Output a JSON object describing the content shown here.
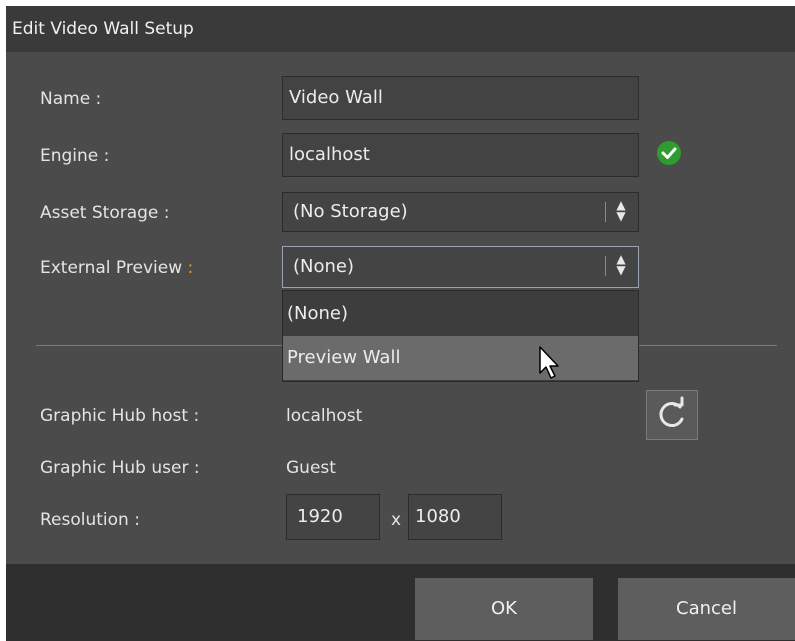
{
  "dialog": {
    "title": "Edit Video Wall Setup"
  },
  "form": {
    "name_label": "Name :",
    "name_value": "Video Wall",
    "engine_label": "Engine :",
    "engine_value": "localhost",
    "asset_storage_label": "Asset Storage :",
    "asset_storage_value": "(No Storage)",
    "external_preview_label": "External Preview",
    "external_preview_colon": ":",
    "external_preview_value": "(None)"
  },
  "dropdown": {
    "options": [
      "(None)",
      "Preview Wall"
    ],
    "hovered": "Preview Wall"
  },
  "graphic_hub": {
    "host_label": "Graphic Hub host :",
    "host_value": "localhost",
    "user_label": "Graphic Hub user :",
    "user_value": "Guest"
  },
  "resolution": {
    "label": "Resolution :",
    "width": "1920",
    "separator": "x",
    "height": "1080"
  },
  "buttons": {
    "ok": "OK",
    "cancel": "Cancel"
  },
  "icons": {
    "engine_status": "check-circle-icon",
    "refresh": "refresh-icon",
    "select_arrows": "up-down-arrows-icon"
  },
  "colors": {
    "status_ok": "#2e9c2e",
    "accent_colon": "#e0a020"
  }
}
